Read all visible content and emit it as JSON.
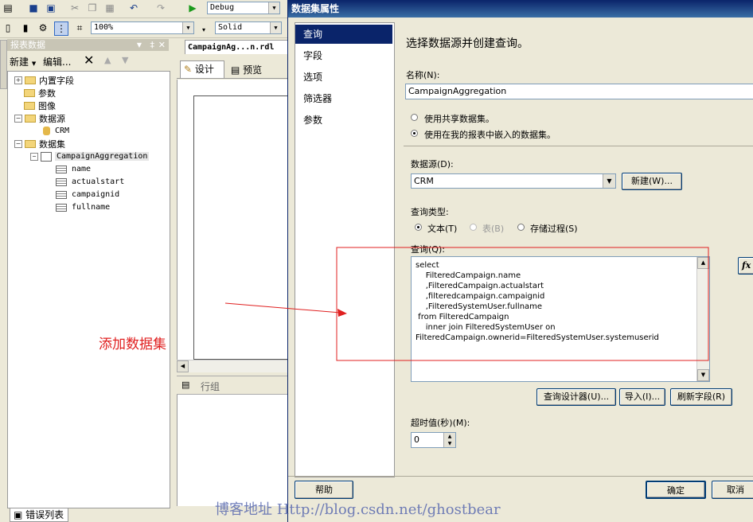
{
  "toolbar": {
    "config_value": "Debug",
    "zoom_value": "100%",
    "border_style_value": "Solid"
  },
  "report_data_panel": {
    "title": "报表数据",
    "new_label": "新建",
    "edit_label": "编辑...",
    "tree": {
      "builtin_fields": "内置字段",
      "parameters": "参数",
      "images": "图像",
      "data_sources": "数据源",
      "data_source_item": "CRM",
      "datasets": "数据集",
      "dataset_item": "CampaignAggregation",
      "fields": [
        "name",
        "actualstart",
        "campaignid",
        "fullname"
      ]
    }
  },
  "designer": {
    "tab_title": "CampaignAg...n.rdl",
    "design_tab": "设计",
    "preview_tab": "预览",
    "row_groups_label": "行组"
  },
  "error_list_tab": "错误列表",
  "annotation": {
    "text": "添加数据集",
    "color": "#e02020"
  },
  "watermark": "博客地址 Http://blog.csdn.net/ghostbear",
  "dialog": {
    "title": "数据集属性",
    "nav": [
      "查询",
      "字段",
      "选项",
      "筛选器",
      "参数"
    ],
    "heading": "选择数据源并创建查询。",
    "name_label": "名称(N):",
    "name_value": "CampaignAggregation",
    "radio_shared": "使用共享数据集。",
    "radio_embedded": "使用在我的报表中嵌入的数据集。",
    "datasource_label": "数据源(D):",
    "datasource_value": "CRM",
    "new_button": "新建(W)...",
    "query_type_label": "查询类型:",
    "query_type_text": "文本(T)",
    "query_type_table": "表(B)",
    "query_type_proc": "存储过程(S)",
    "query_label": "查询(Q):",
    "query_lines": [
      "select",
      "    FilteredCampaign.name",
      "    ,FilteredCampaign.actualstart",
      "    ,filteredcampaign.campaignid",
      "    ,FilteredSystemUser.fullname",
      " from FilteredCampaign",
      "    inner join FilteredSystemUser on",
      "FilteredCampaign.ownerid=FilteredSystemUser.systemuserid"
    ],
    "fx_button": "fx",
    "query_designer_button": "查询设计器(U)...",
    "import_button": "导入(I)...",
    "refresh_fields_button": "刷新字段(R)",
    "timeout_label": "超时值(秒)(M):",
    "timeout_value": "0",
    "help_button": "帮助",
    "ok_button": "确定",
    "cancel_button": "取消"
  }
}
